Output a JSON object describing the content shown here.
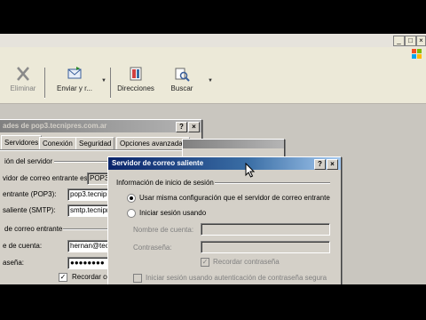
{
  "window": {
    "minimize": "_",
    "maximize": "□",
    "close": "×"
  },
  "toolbar": {
    "delete_label": "Eliminar",
    "send_receive_label": "Enviar y r...",
    "addresses_label": "Direcciones",
    "find_label": "Buscar"
  },
  "props_dialog": {
    "title": "ades de pop3.tecnipres.com.ar",
    "help": "?",
    "close": "×",
    "tabs": [
      "Servidores",
      "Conexión",
      "Seguridad",
      "Opciones avanzadas"
    ],
    "server_info_heading": "ión del servidor",
    "incoming_type_label": "vidor de correo entrante es",
    "incoming_type_value": "POP3",
    "incoming_label": "entrante (POP3):",
    "incoming_value": "pop3.tecnipr",
    "outgoing_label": "saliente (SMTP):",
    "outgoing_value": "smtp.tecnipr",
    "incoming_mail_heading": "de correo entrante",
    "account_label": "e de cuenta:",
    "account_value": "hernan@tecn",
    "password_label": "aseña:",
    "password_value": "●●●●●●●●",
    "remember_label": "Recordar co",
    "remember_checked": "✓"
  },
  "smtp_dialog": {
    "title": "Servidor de correo saliente",
    "help": "?",
    "close": "×",
    "group_label": "Información de inicio de sesión",
    "option_same": "Usar misma configuración que el servidor de correo entrante",
    "option_login": "Iniciar sesión usando",
    "account_name_label": "Nombre de cuenta:",
    "password_label": "Contraseña:",
    "remember_label": "Recordar contraseña",
    "remember_checked": "✓",
    "spa_label": "Iniciar sesión usando autenticación de contraseña segura"
  }
}
